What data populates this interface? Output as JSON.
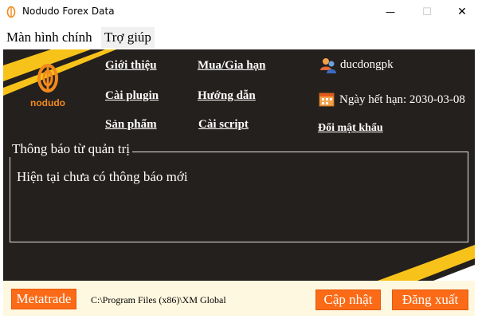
{
  "window": {
    "title": "Nodudo Forex Data",
    "minimize_glyph": "—",
    "maximize_glyph": "☐",
    "close_glyph": "✕"
  },
  "menu": {
    "tabs": [
      {
        "label": "Màn hình chính"
      },
      {
        "label": "Trợ giúp"
      }
    ]
  },
  "brand": {
    "logo_text": "nodudo",
    "accent_color": "#f28a1c"
  },
  "links": [
    {
      "label": "Giới thiệu"
    },
    {
      "label": "Mua/Gia hạn"
    },
    {
      "label": "Cài plugin"
    },
    {
      "label": "Hướng dẫn"
    },
    {
      "label": "Sản phẩm"
    },
    {
      "label": "Cài script"
    }
  ],
  "account": {
    "username": "ducdongpk",
    "user_icon": "users-icon",
    "expiry": "Ngày hết hạn: 2030-03-08",
    "calendar_icon": "calendar-icon",
    "change_password": "Đổi mật khẩu"
  },
  "notice": {
    "legend": "Thông báo từ quản trị",
    "message": "Hiện tại chưa có thông báo mới"
  },
  "footer": {
    "metatrade_label": "Metatrade",
    "path": "C:\\Program Files (x86)\\XM Global",
    "update_label": "Cập nhật",
    "logout_label": "Đăng xuất",
    "button_color": "#fb6a16"
  }
}
